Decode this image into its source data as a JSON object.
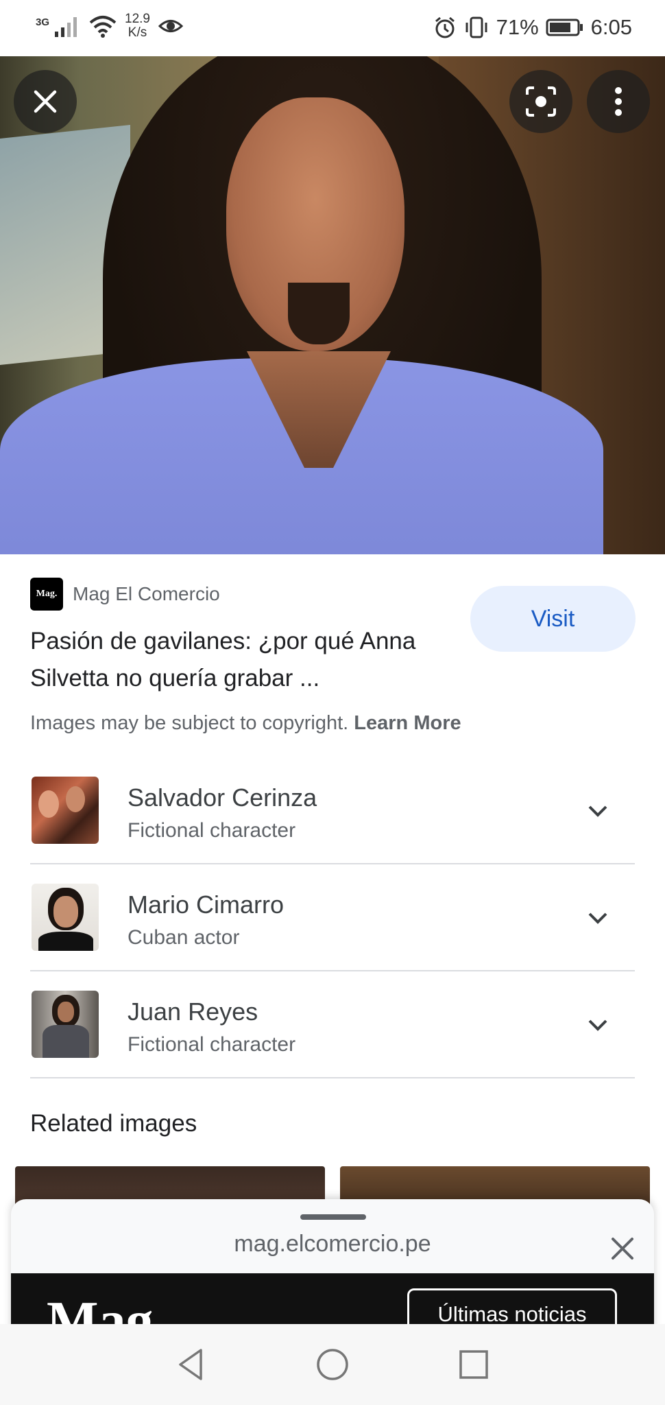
{
  "status_bar": {
    "network_type": "3G",
    "speed_value": "12.9",
    "speed_unit": "K/s",
    "battery": "71%",
    "time": "6:05"
  },
  "icons": {
    "close": "close-icon",
    "lens": "lens-icon",
    "more": "more-vert-icon",
    "chevron": "chevron-down-icon"
  },
  "source": {
    "logo_text": "Mag.",
    "name": "Mag El Comercio"
  },
  "result": {
    "title": "Pasión de gavilanes: ¿por qué Anna Silvetta no quería grabar ...",
    "visit_label": "Visit",
    "copyright_text": "Images may be subject to copyright.",
    "learn_more": "Learn More"
  },
  "entities": [
    {
      "name": "Salvador Cerinza",
      "description": "Fictional character"
    },
    {
      "name": "Mario Cimarro",
      "description": "Cuban actor"
    },
    {
      "name": "Juan Reyes",
      "description": "Fictional character"
    }
  ],
  "related": {
    "title": "Related images"
  },
  "sheet": {
    "url": "mag.elcomercio.pe",
    "site_logo": "Mag",
    "site_button": "Últimas noticias"
  },
  "colors": {
    "accent": "#1a5bc4",
    "visit_bg": "#e8f0fe",
    "divider": "#dadce0"
  }
}
